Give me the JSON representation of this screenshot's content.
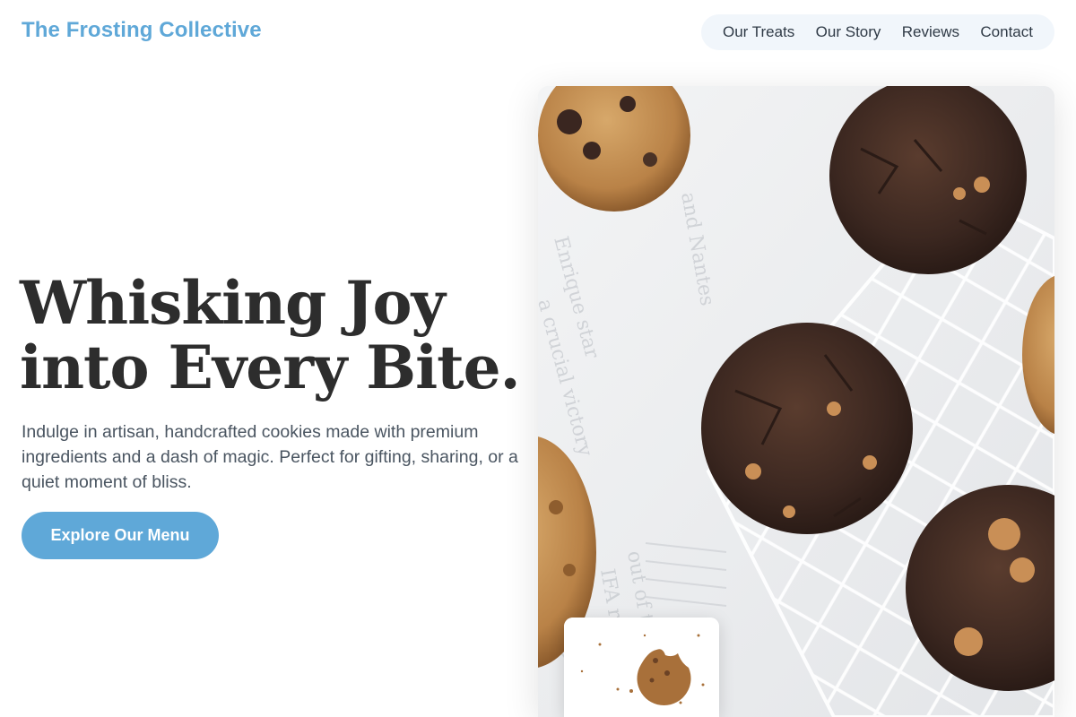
{
  "brand": {
    "name": "The Frosting Collective"
  },
  "nav": {
    "items": [
      {
        "label": "Our Treats"
      },
      {
        "label": "Our Story"
      },
      {
        "label": "Reviews"
      },
      {
        "label": "Contact"
      }
    ]
  },
  "hero": {
    "title_line1": "Whisking Joy",
    "title_line2": "into Every Bite.",
    "description": "Indulge in artisan, handcrafted cookies made with premium ingredients and a dash of magic. Perfect for gifting, sharing, or a quiet moment of bliss.",
    "cta_label": "Explore Our Menu"
  },
  "colors": {
    "accent": "#5fa8d8",
    "heading": "#2d2d2d",
    "body_text": "#4a5561",
    "nav_bg": "#f1f6fb"
  },
  "images": {
    "main": "cookies-on-cooling-rack-photo",
    "inset": "bitten-cookie-photo"
  }
}
